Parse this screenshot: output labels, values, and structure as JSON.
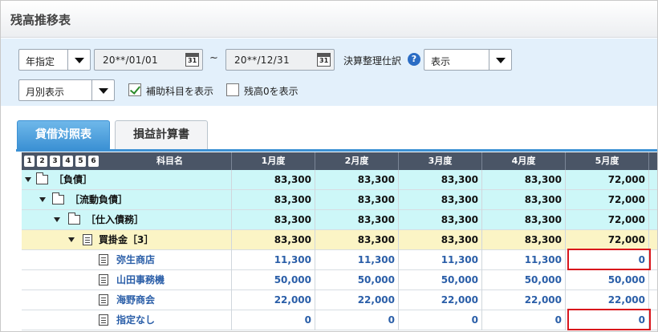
{
  "window": {
    "title": "残高推移表"
  },
  "filters": {
    "period_type": "年指定",
    "date_from": "20**/01/01",
    "date_to": "20**/12/31",
    "calendar_icon_text": "31",
    "range_separator": "~",
    "closing_label": "決算整理仕訳",
    "closing_value": "表示",
    "display_mode": "月別表示",
    "show_sub_accounts_label": "補助科目を表示",
    "show_sub_accounts_checked": true,
    "show_zero_label": "残高0を表示",
    "show_zero_checked": false
  },
  "tabs": [
    {
      "label": "貸借対照表",
      "active": true
    },
    {
      "label": "損益計算書",
      "active": false
    }
  ],
  "table": {
    "level_buttons": [
      "1",
      "2",
      "3",
      "4",
      "5",
      "6"
    ],
    "columns": [
      "科目名",
      "1月度",
      "2月度",
      "3月度",
      "4月度",
      "5月度"
    ],
    "rows": [
      {
        "name": "［負債］",
        "type": "folder",
        "style": "cyan",
        "values": [
          "83,300",
          "83,300",
          "83,300",
          "83,300",
          "72,000"
        ]
      },
      {
        "name": "［流動負債］",
        "type": "folder",
        "style": "cyan",
        "values": [
          "83,300",
          "83,300",
          "83,300",
          "83,300",
          "72,000"
        ]
      },
      {
        "name": "［仕入債務］",
        "type": "folder",
        "style": "cyan",
        "values": [
          "83,300",
          "83,300",
          "83,300",
          "83,300",
          "72,000"
        ]
      },
      {
        "name": "買掛金［3］",
        "type": "account",
        "style": "yellow",
        "values": [
          "83,300",
          "83,300",
          "83,300",
          "83,300",
          "72,000"
        ]
      },
      {
        "name": "弥生商店",
        "type": "sub",
        "style": "white",
        "values": [
          "11,300",
          "11,300",
          "11,300",
          "11,300",
          "0"
        ]
      },
      {
        "name": "山田事務機",
        "type": "sub",
        "style": "white",
        "values": [
          "50,000",
          "50,000",
          "50,000",
          "50,000",
          "50,000"
        ]
      },
      {
        "name": "海野商会",
        "type": "sub",
        "style": "white",
        "values": [
          "22,000",
          "22,000",
          "22,000",
          "22,000",
          "22,000"
        ]
      },
      {
        "name": "指定なし",
        "type": "sub",
        "style": "white",
        "values": [
          "0",
          "0",
          "0",
          "0",
          "0"
        ]
      }
    ]
  },
  "colors": {
    "filter_bg": "#e3f0fb",
    "header_bg": "#4a5566",
    "group_row": "#cdf7f8",
    "account_row": "#fbf4c5",
    "sub_text": "#2a5ea8",
    "highlight": "#d9141b",
    "tab_active": "#3c91d4"
  }
}
